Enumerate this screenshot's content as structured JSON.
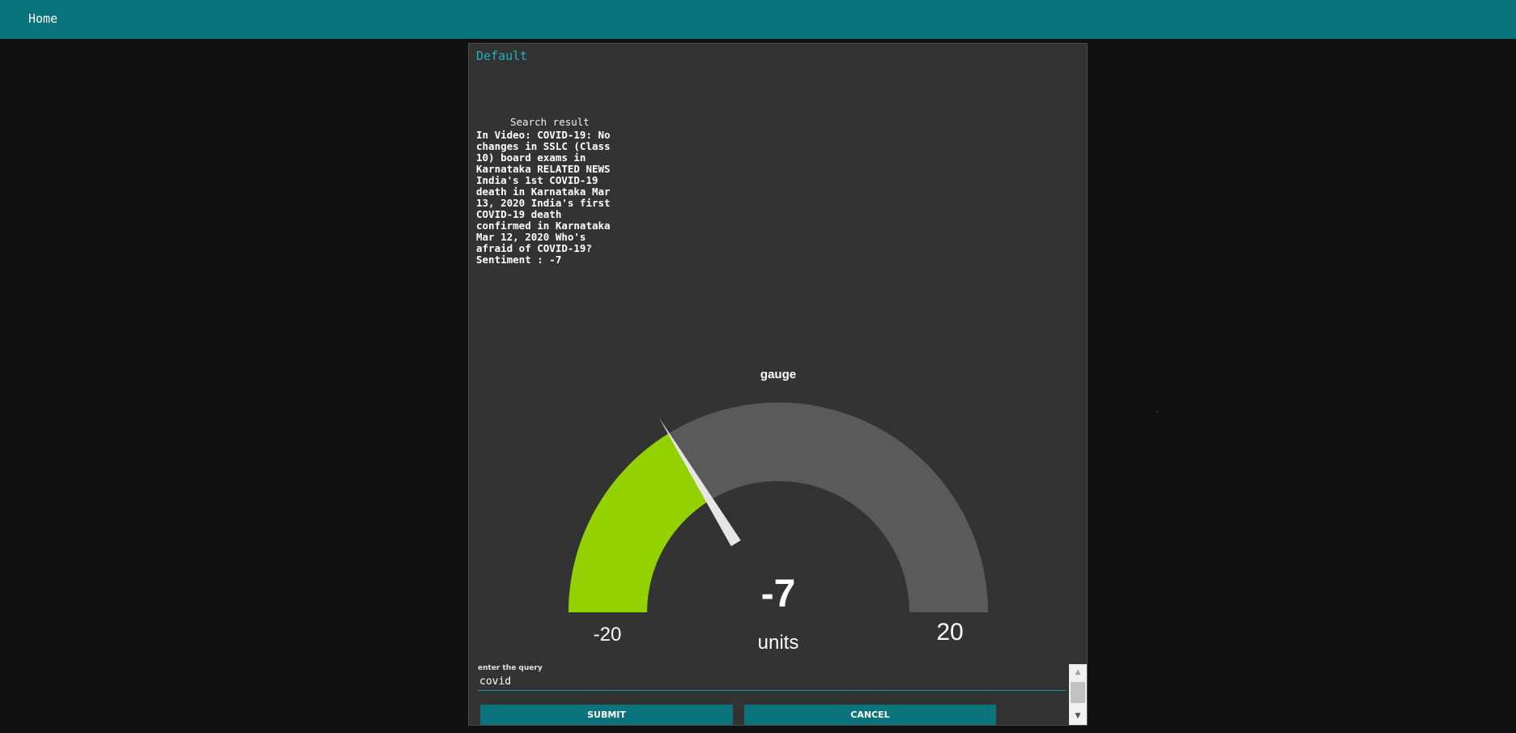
{
  "nav": {
    "home_label": "Home"
  },
  "panel": {
    "title": "Default",
    "search_heading": "Search result",
    "search_text": "In Video: COVID-19: No changes in SSLC (Class 10) board exams in Karnataka RELATED NEWS India's 1st COVID-19 death in Karnataka Mar 13, 2020 India's first COVID-19 death confirmed in Karnataka Mar 12, 2020 Who's afraid of COVID-19?Sentiment : -7"
  },
  "chart_data": {
    "type": "gauge",
    "title": "gauge",
    "value": -7,
    "value_label": "-7",
    "min": -20,
    "max": 20,
    "min_label": "-20",
    "max_label": "20",
    "units": "units",
    "colors": {
      "fill": "#93d200",
      "track": "#5a5a5a",
      "needle": "#e6e6e6",
      "text": "#ffffff"
    }
  },
  "form": {
    "query_label": "enter the query",
    "query_value": "covid",
    "submit_label": "SUBMIT",
    "cancel_label": "CANCEL"
  },
  "icons": {
    "scroll_up": "scroll-up-arrow-icon",
    "scroll_down": "scroll-down-arrow-icon"
  }
}
